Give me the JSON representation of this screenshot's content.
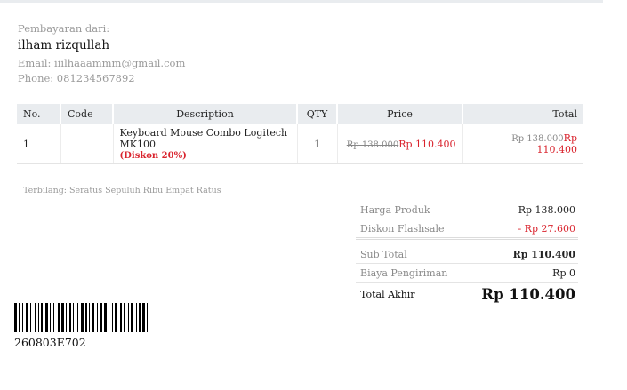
{
  "payer": {
    "label": "Pembayaran dari:",
    "name": "ilham rizqullah",
    "email": "Email: iiilhaaammm@gmail.com",
    "phone": "Phone: 081234567892"
  },
  "table": {
    "headers": {
      "no": "No.",
      "code": "Code",
      "description": "Description",
      "qty": "QTY",
      "price": "Price",
      "total": "Total"
    },
    "rows": [
      {
        "no": "1",
        "code": "",
        "description": "Keyboard Mouse Combo Logitech MK100",
        "discount_label": "(Diskon 20%)",
        "qty": "1",
        "price_original": "Rp 138.000",
        "price": "Rp 110.400",
        "total_original": "Rp 138.000",
        "total": "Rp 110.400"
      }
    ]
  },
  "terbilang": "Terbilang: Seratus Sepuluh Ribu Empat Ratus",
  "summary": {
    "harga_produk_label": "Harga Produk",
    "harga_produk_value": "Rp 138.000",
    "diskon_label": "Diskon Flashsale",
    "diskon_value": "- Rp 27.600",
    "subtotal_label": "Sub Total",
    "subtotal_value": "Rp 110.400",
    "ongkir_label": "Biaya Pengiriman",
    "ongkir_value": "Rp 0",
    "total_label": "Total Akhir",
    "total_value": "Rp 110.400"
  },
  "barcode": {
    "text": "260803E702"
  },
  "colors": {
    "header_bg": "#e9ecef",
    "discount_red": "#d9232d",
    "muted": "#9a9a9a"
  }
}
